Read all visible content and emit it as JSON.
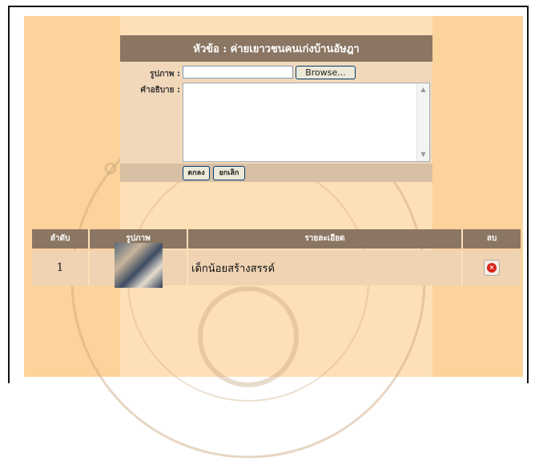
{
  "form": {
    "title": "หัวข้อ : ค่ายเยาวชนคนเก่งบ้านอัษฎา",
    "image_label": "รูปภาพ :",
    "file_value": "",
    "browse_label": "Browse...",
    "description_label": "คำอธิบาย :",
    "description_value": "",
    "ok_label": "ตกลง",
    "cancel_label": "ยกเลิก"
  },
  "table": {
    "headers": [
      "ลำดับ",
      "รูปภาพ",
      "รายละเอียด",
      "ลบ"
    ],
    "rows": [
      {
        "index": "1",
        "detail": "เด็กน้อยสร้างสรรค์"
      }
    ]
  },
  "colors": {
    "header_bg": "#8b7663",
    "canvas_bg": "#fcd39a",
    "delete_icon": "#d9231b"
  }
}
